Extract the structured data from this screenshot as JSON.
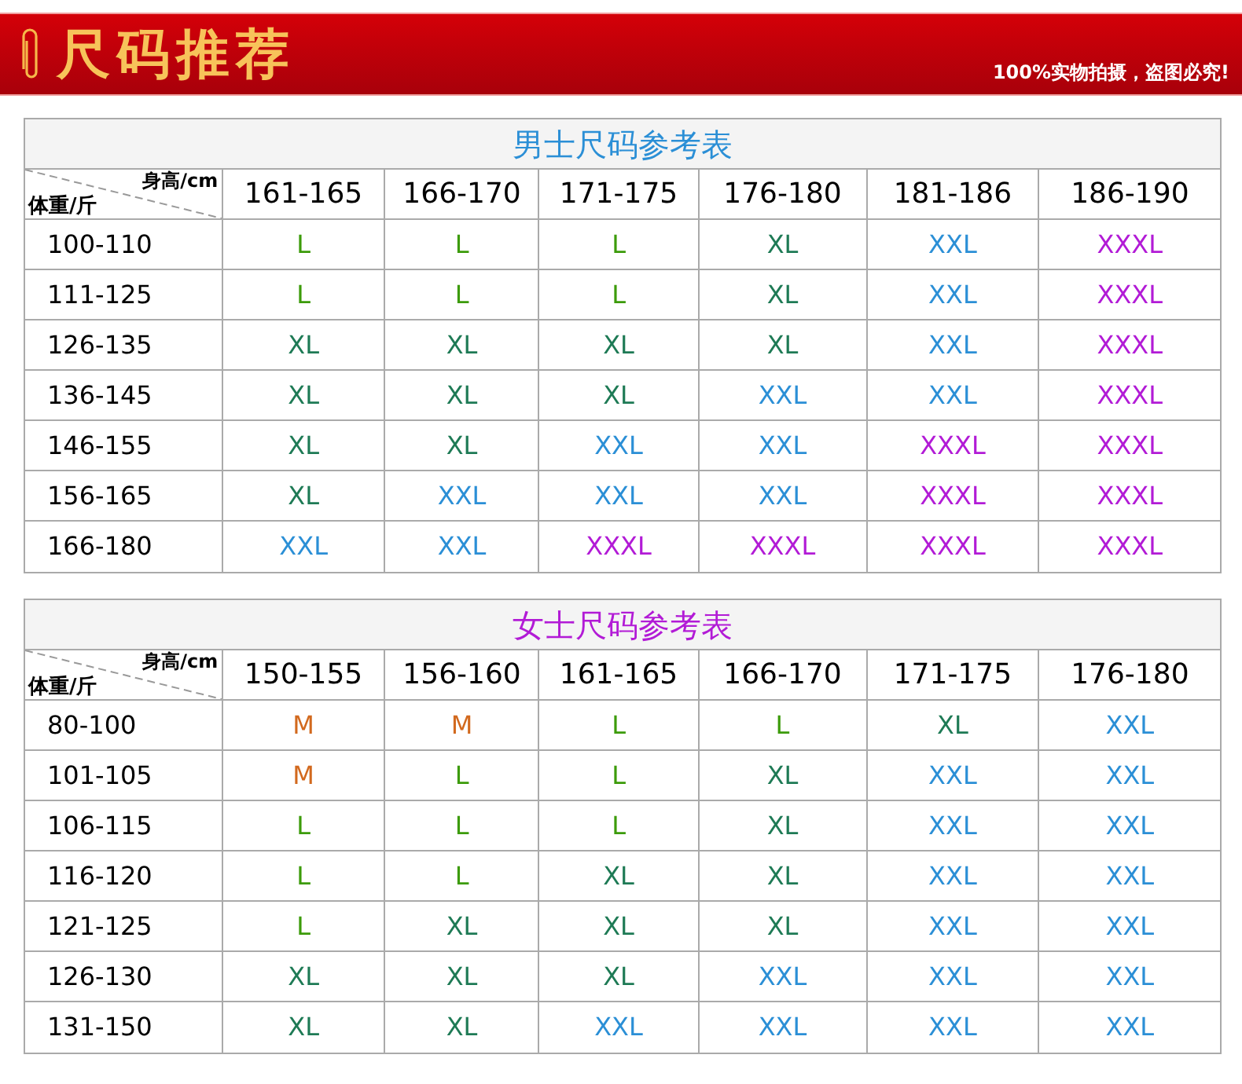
{
  "banner": {
    "title": "尺码推荐",
    "notice": "100%实物拍摄，盗图必究!"
  },
  "tables": [
    {
      "title": "男士尺码参考表",
      "color": "#2b8fd6",
      "corner_top": "身高/cm",
      "corner_bottom": "体重/斤",
      "columns": [
        "161-165",
        "166-170",
        "171-175",
        "176-180",
        "181-186",
        "186-190"
      ],
      "rows": [
        {
          "weight": "100-110",
          "cells": [
            {
              "text": "L",
              "color": "#3c9b0a"
            },
            {
              "text": "L",
              "color": "#3c9b0a"
            },
            {
              "text": "L",
              "color": "#3c9b0a"
            },
            {
              "text": "XL",
              "color": "#1e7a55"
            },
            {
              "text": "XXL",
              "color": "#2b8fd6"
            },
            {
              "text": "XXXL",
              "color": "#b21bd6"
            }
          ]
        },
        {
          "weight": "111-125",
          "cells": [
            {
              "text": "L",
              "color": "#3c9b0a"
            },
            {
              "text": "L",
              "color": "#3c9b0a"
            },
            {
              "text": "L",
              "color": "#3c9b0a"
            },
            {
              "text": "XL",
              "color": "#1e7a55"
            },
            {
              "text": "XXL",
              "color": "#2b8fd6"
            },
            {
              "text": "XXXL",
              "color": "#b21bd6"
            }
          ]
        },
        {
          "weight": "126-135",
          "cells": [
            {
              "text": "XL",
              "color": "#1e7a55"
            },
            {
              "text": "XL",
              "color": "#1e7a55"
            },
            {
              "text": "XL",
              "color": "#1e7a55"
            },
            {
              "text": "XL",
              "color": "#1e7a55"
            },
            {
              "text": "XXL",
              "color": "#2b8fd6"
            },
            {
              "text": "XXXL",
              "color": "#b21bd6"
            }
          ]
        },
        {
          "weight": "136-145",
          "cells": [
            {
              "text": "XL",
              "color": "#1e7a55"
            },
            {
              "text": "XL",
              "color": "#1e7a55"
            },
            {
              "text": "XL",
              "color": "#1e7a55"
            },
            {
              "text": "XXL",
              "color": "#2b8fd6"
            },
            {
              "text": "XXL",
              "color": "#2b8fd6"
            },
            {
              "text": "XXXL",
              "color": "#b21bd6"
            }
          ]
        },
        {
          "weight": "146-155",
          "cells": [
            {
              "text": "XL",
              "color": "#1e7a55"
            },
            {
              "text": "XL",
              "color": "#1e7a55"
            },
            {
              "text": "XXL",
              "color": "#2b8fd6"
            },
            {
              "text": "XXL",
              "color": "#2b8fd6"
            },
            {
              "text": "XXXL",
              "color": "#b21bd6"
            },
            {
              "text": "XXXL",
              "color": "#b21bd6"
            }
          ]
        },
        {
          "weight": "156-165",
          "cells": [
            {
              "text": "XL",
              "color": "#1e7a55"
            },
            {
              "text": "XXL",
              "color": "#2b8fd6"
            },
            {
              "text": "XXL",
              "color": "#2b8fd6"
            },
            {
              "text": "XXL",
              "color": "#2b8fd6"
            },
            {
              "text": "XXXL",
              "color": "#b21bd6"
            },
            {
              "text": "XXXL",
              "color": "#b21bd6"
            }
          ]
        },
        {
          "weight": "166-180",
          "cells": [
            {
              "text": "XXL",
              "color": "#2b8fd6"
            },
            {
              "text": "XXL",
              "color": "#2b8fd6"
            },
            {
              "text": "XXXL",
              "color": "#b21bd6"
            },
            {
              "text": "XXXL",
              "color": "#b21bd6"
            },
            {
              "text": "XXXL",
              "color": "#b21bd6"
            },
            {
              "text": "XXXL",
              "color": "#b21bd6"
            }
          ]
        }
      ]
    },
    {
      "title": "女士尺码参考表",
      "color": "#b21bd6",
      "corner_top": "身高/cm",
      "corner_bottom": "体重/斤",
      "columns": [
        "150-155",
        "156-160",
        "161-165",
        "166-170",
        "171-175",
        "176-180"
      ],
      "rows": [
        {
          "weight": "80-100",
          "cells": [
            {
              "text": "M",
              "color": "#d2691e"
            },
            {
              "text": "M",
              "color": "#d2691e"
            },
            {
              "text": "L",
              "color": "#3c9b0a"
            },
            {
              "text": "L",
              "color": "#3c9b0a"
            },
            {
              "text": "XL",
              "color": "#1e7a55"
            },
            {
              "text": "XXL",
              "color": "#2b8fd6"
            }
          ]
        },
        {
          "weight": "101-105",
          "cells": [
            {
              "text": "M",
              "color": "#d2691e"
            },
            {
              "text": "L",
              "color": "#3c9b0a"
            },
            {
              "text": "L",
              "color": "#3c9b0a"
            },
            {
              "text": "XL",
              "color": "#1e7a55"
            },
            {
              "text": "XXL",
              "color": "#2b8fd6"
            },
            {
              "text": "XXL",
              "color": "#2b8fd6"
            }
          ]
        },
        {
          "weight": "106-115",
          "cells": [
            {
              "text": "L",
              "color": "#3c9b0a"
            },
            {
              "text": "L",
              "color": "#3c9b0a"
            },
            {
              "text": "L",
              "color": "#3c9b0a"
            },
            {
              "text": "XL",
              "color": "#1e7a55"
            },
            {
              "text": "XXL",
              "color": "#2b8fd6"
            },
            {
              "text": "XXL",
              "color": "#2b8fd6"
            }
          ]
        },
        {
          "weight": "116-120",
          "cells": [
            {
              "text": "L",
              "color": "#3c9b0a"
            },
            {
              "text": "L",
              "color": "#3c9b0a"
            },
            {
              "text": "XL",
              "color": "#1e7a55"
            },
            {
              "text": "XL",
              "color": "#1e7a55"
            },
            {
              "text": "XXL",
              "color": "#2b8fd6"
            },
            {
              "text": "XXL",
              "color": "#2b8fd6"
            }
          ]
        },
        {
          "weight": "121-125",
          "cells": [
            {
              "text": "L",
              "color": "#3c9b0a"
            },
            {
              "text": "XL",
              "color": "#1e7a55"
            },
            {
              "text": "XL",
              "color": "#1e7a55"
            },
            {
              "text": "XL",
              "color": "#1e7a55"
            },
            {
              "text": "XXL",
              "color": "#2b8fd6"
            },
            {
              "text": "XXL",
              "color": "#2b8fd6"
            }
          ]
        },
        {
          "weight": "126-130",
          "cells": [
            {
              "text": "XL",
              "color": "#1e7a55"
            },
            {
              "text": "XL",
              "color": "#1e7a55"
            },
            {
              "text": "XL",
              "color": "#1e7a55"
            },
            {
              "text": "XXL",
              "color": "#2b8fd6"
            },
            {
              "text": "XXL",
              "color": "#2b8fd6"
            },
            {
              "text": "XXL",
              "color": "#2b8fd6"
            }
          ]
        },
        {
          "weight": "131-150",
          "cells": [
            {
              "text": "XL",
              "color": "#1e7a55"
            },
            {
              "text": "XL",
              "color": "#1e7a55"
            },
            {
              "text": "XXL",
              "color": "#2b8fd6"
            },
            {
              "text": "XXL",
              "color": "#2b8fd6"
            },
            {
              "text": "XXL",
              "color": "#2b8fd6"
            },
            {
              "text": "XXL",
              "color": "#2b8fd6"
            }
          ]
        }
      ]
    }
  ]
}
